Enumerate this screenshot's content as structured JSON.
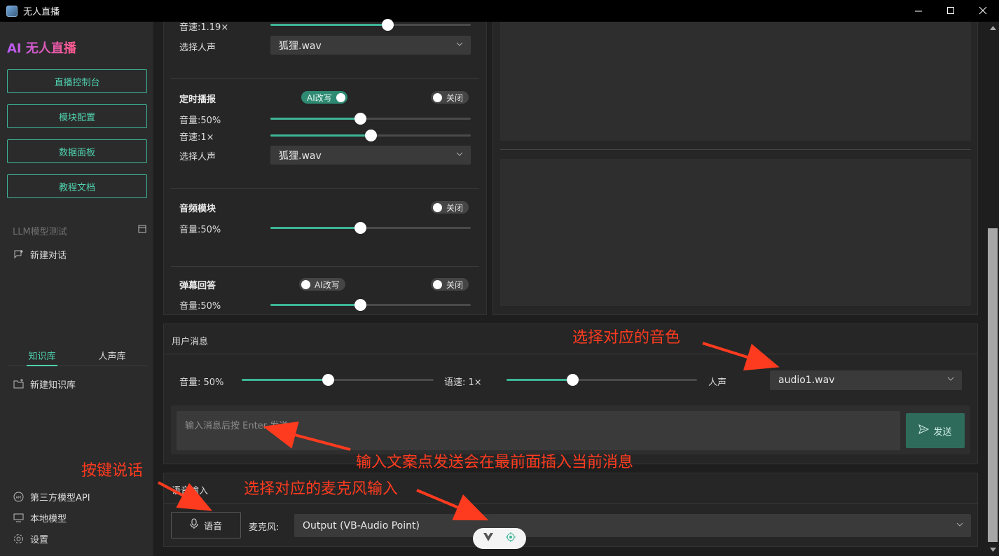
{
  "window": {
    "title": "无人直播"
  },
  "sidebar": {
    "brand": "AI 无人直播",
    "nav": [
      "直播控制台",
      "模块配置",
      "数据面板",
      "教程文档"
    ],
    "llm_section_label": "LLM模型测试",
    "new_chat": "新建对话",
    "tabs": [
      "知识库",
      "人声库"
    ],
    "new_kb": "新建知识库",
    "bottom": [
      "第三方模型API",
      "本地模型",
      "设置"
    ]
  },
  "modules": {
    "speech_top": {
      "speed_label": "音速:1.19×",
      "speed_value": 1.19,
      "voice_label": "选择人声",
      "voice_value": "狐狸.wav"
    },
    "timed": {
      "title": "定时播报",
      "ai_toggle": "AI改写",
      "ai_on": true,
      "switch": "关闭",
      "switch_on": false,
      "volume_label": "音量:50%",
      "volume": 50,
      "speed_label": "音速:1×",
      "speed": 1,
      "voice_label": "选择人声",
      "voice_value": "狐狸.wav"
    },
    "audio": {
      "title": "音频模块",
      "switch": "关闭",
      "switch_on": false,
      "volume_label": "音量:50%",
      "volume": 50
    },
    "danmaku": {
      "title": "弹幕回答",
      "ai_toggle": "AI改写",
      "ai_on": false,
      "switch": "关闭",
      "switch_on": false,
      "volume_label": "音量:50%",
      "volume": 50
    }
  },
  "user_message": {
    "title": "用户消息",
    "volume_label": "音量: 50%",
    "volume": 50,
    "speed_label": "语速: 1×",
    "speed": 1,
    "voice_label": "人声",
    "voice_value": "audio1.wav",
    "input_placeholder": "输入消息后按 Enter 发送",
    "send": "发送"
  },
  "voice_input": {
    "title": "语音输入",
    "voice_button": "语音",
    "mic_label": "麦克风:",
    "mic_value": "Output (VB-Audio Point)"
  },
  "annotations": {
    "voice_color": "选择对应的音色",
    "insert_message": "输入文案点发送会在最前面插入当前消息",
    "push_to_talk": "按键说话",
    "mic_select": "选择对应的麦克风输入"
  },
  "colors": {
    "accent": "#3db596",
    "annotation": "#ff3b1f",
    "brand_start": "#b85cf5",
    "brand_end": "#ff5a8a"
  }
}
